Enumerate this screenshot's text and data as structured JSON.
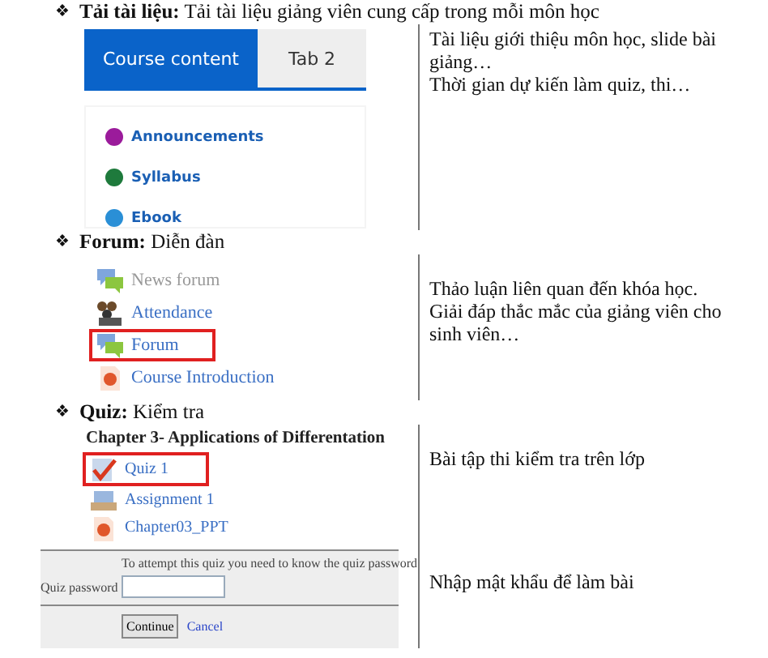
{
  "sections": [
    {
      "bullet": "❖",
      "heading": "**Tải tài liệu:** Tải tài liệu giảng viên cung cấp trong mỗi môn học",
      "kind": "tabs",
      "tabs": [
        {
          "label": "Course content",
          "selected": true
        },
        {
          "label": "Tab 2",
          "selected": false
        }
      ],
      "items": [
        {
          "label": "Announcements",
          "color": "#9b1b9b"
        },
        {
          "label": "Syllabus",
          "color": "#1e7a3c"
        },
        {
          "label": "Ebook",
          "color": "#2a8fd6"
        }
      ],
      "notes": [
        "Tài liệu giới thiệu môn học, slide bài giảng…",
        "Thời gian dự kiến làm quiz, thi…"
      ]
    },
    {
      "bullet": "❖",
      "heading": "**Forum:** Diễn đàn",
      "kind": "activities",
      "items": [
        {
          "label": "News forum",
          "kind": "forum",
          "dimmed": true,
          "highlighted": false
        },
        {
          "label": "Attendance",
          "kind": "attendance",
          "dimmed": false,
          "highlighted": false
        },
        {
          "label": "Forum",
          "kind": "forum",
          "dimmed": false,
          "highlighted": true
        },
        {
          "label": "Course Introduction",
          "kind": "file",
          "dimmed": false,
          "highlighted": false
        }
      ],
      "notes": [
        "Thảo luận liên quan đến khóa học. Giải đáp thắc mắc của giảng viên cho sinh viên…"
      ]
    },
    {
      "bullet": "❖",
      "heading": "**Quiz:** Kiểm tra",
      "kind": "quiz",
      "title": "Chapter 3- Applications of Differentation",
      "items": [
        {
          "label": "Quiz 1",
          "kind": "quiz",
          "dimmed": false,
          "highlighted": true
        },
        {
          "label": "Assignment 1",
          "kind": "assignment",
          "dimmed": false,
          "highlighted": false
        },
        {
          "label": "Chapter03_PPT",
          "kind": "file",
          "dimmed": false,
          "highlighted": false
        }
      ],
      "password": {
        "hint": "To attempt this quiz you need to know the quiz password",
        "label": "Quiz password",
        "buttons": [
          {
            "label": "Continue",
            "kind": "button"
          },
          {
            "label": "Cancel",
            "kind": "link"
          }
        ]
      },
      "notes": [
        "Bài tập thi kiểm tra trên lớp",
        "Nhập mật khẩu để làm bài"
      ]
    }
  ]
}
